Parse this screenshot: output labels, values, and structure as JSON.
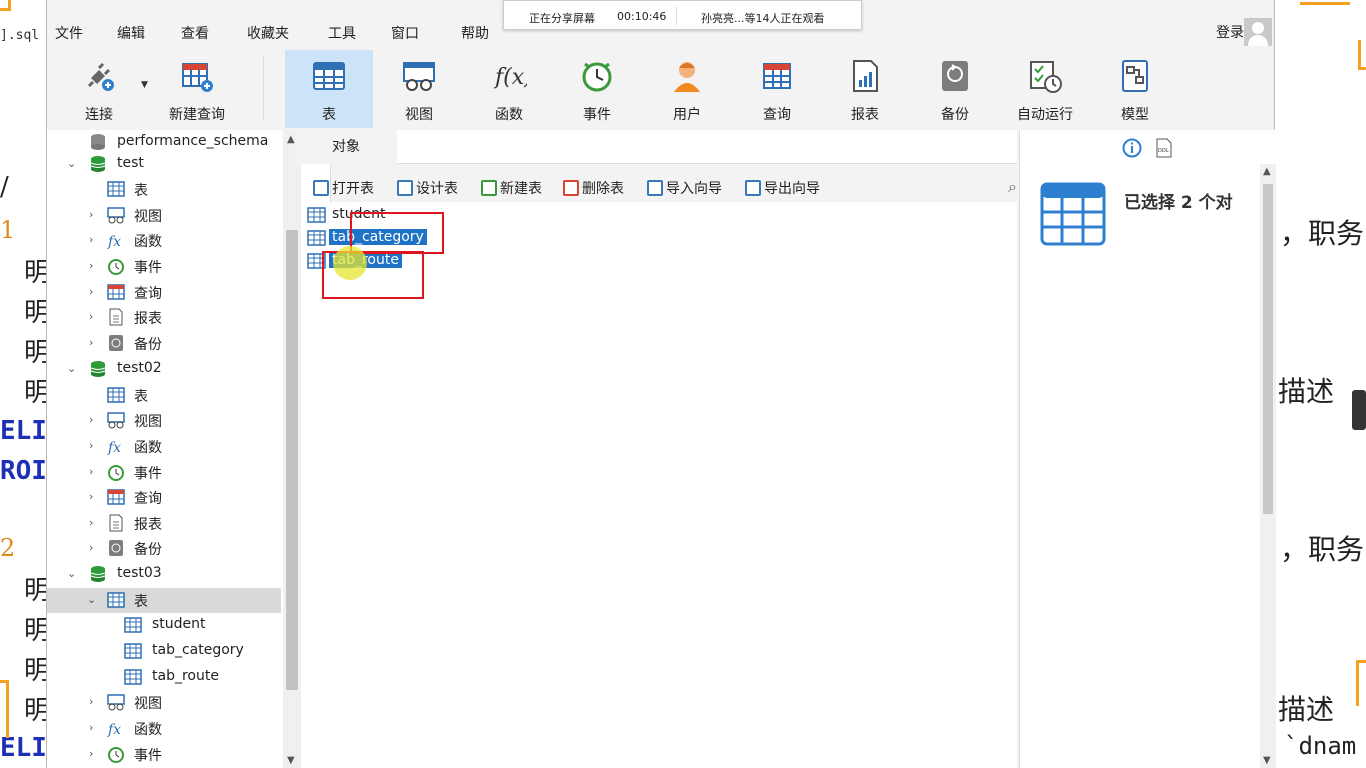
{
  "background": {
    "tab_text": "].sql",
    "left_text": [
      "/",
      "1",
      "明",
      "明",
      "明",
      "明",
      "ELI",
      "ROI",
      "2",
      "明",
      "明",
      "明",
      "明",
      "ELI"
    ],
    "right_text": [
      "，职务",
      "描述",
      "，职务",
      "描述",
      "`dnam"
    ]
  },
  "share_banner": {
    "status": "正在分享屏幕",
    "timer": "00:10:46",
    "viewers": "孙亮亮...等14人正在观看"
  },
  "menu": [
    "文件",
    "编辑",
    "查看",
    "收藏夹",
    "工具",
    "窗口",
    "帮助"
  ],
  "login_label": "登录",
  "toolbar": {
    "connect": "连接",
    "new_query": "新建查询",
    "table": "表",
    "view": "视图",
    "function": "函数",
    "event": "事件",
    "user": "用户",
    "query": "查询",
    "report": "报表",
    "backup": "备份",
    "autorun": "自动运行",
    "model": "模型"
  },
  "tree": {
    "perf_schema": "performance_schema",
    "db1": "test",
    "db2": "test02",
    "db3": "test03",
    "nodes": {
      "table": "表",
      "view": "视图",
      "function": "函数",
      "event": "事件",
      "query": "查询",
      "report": "报表",
      "backup": "备份"
    },
    "test03_tables": [
      "student",
      "tab_category",
      "tab_route"
    ]
  },
  "object_tab": "对象",
  "object_toolbar": {
    "open": "打开表",
    "design": "设计表",
    "new": "新建表",
    "delete": "删除表",
    "import": "导入向导",
    "export": "导出向导"
  },
  "objects": [
    "student",
    "tab_category",
    "tab_route"
  ],
  "selected_objects": [
    "tab_category",
    "tab_route"
  ],
  "info_pane": {
    "title": "已选择 2 个对",
    "ddl_label": "DDL"
  },
  "colors": {
    "accent": "#1e73c7",
    "highlight_box": "#e0141e",
    "active_tool": "#cde3f7"
  }
}
